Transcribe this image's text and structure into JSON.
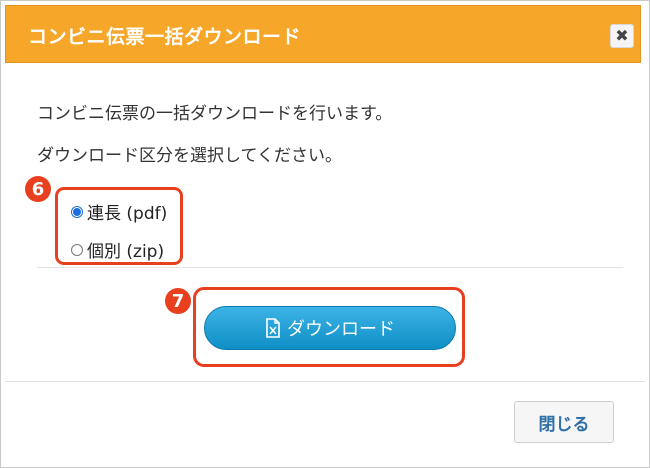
{
  "dialog": {
    "title": "コンビニ伝票一括ダウンロード",
    "close_icon": "close-icon"
  },
  "message": {
    "line1": "コンビニ伝票の一括ダウンロードを行います。",
    "line2": "ダウンロード区分を選択してください。"
  },
  "options": [
    {
      "label": "連長 (pdf)",
      "selected": true
    },
    {
      "label": "個別 (zip)",
      "selected": false
    }
  ],
  "badges": {
    "radios": "6",
    "download": "7"
  },
  "download": {
    "label": "ダウンロード",
    "icon": "excel-file-icon"
  },
  "footer": {
    "close_label": "閉じる"
  },
  "colors": {
    "titlebar": "#f6a72a",
    "accent_button": "#1e9fd8",
    "highlight": "#e8401f",
    "radio_selected": "#1a6ee0"
  }
}
